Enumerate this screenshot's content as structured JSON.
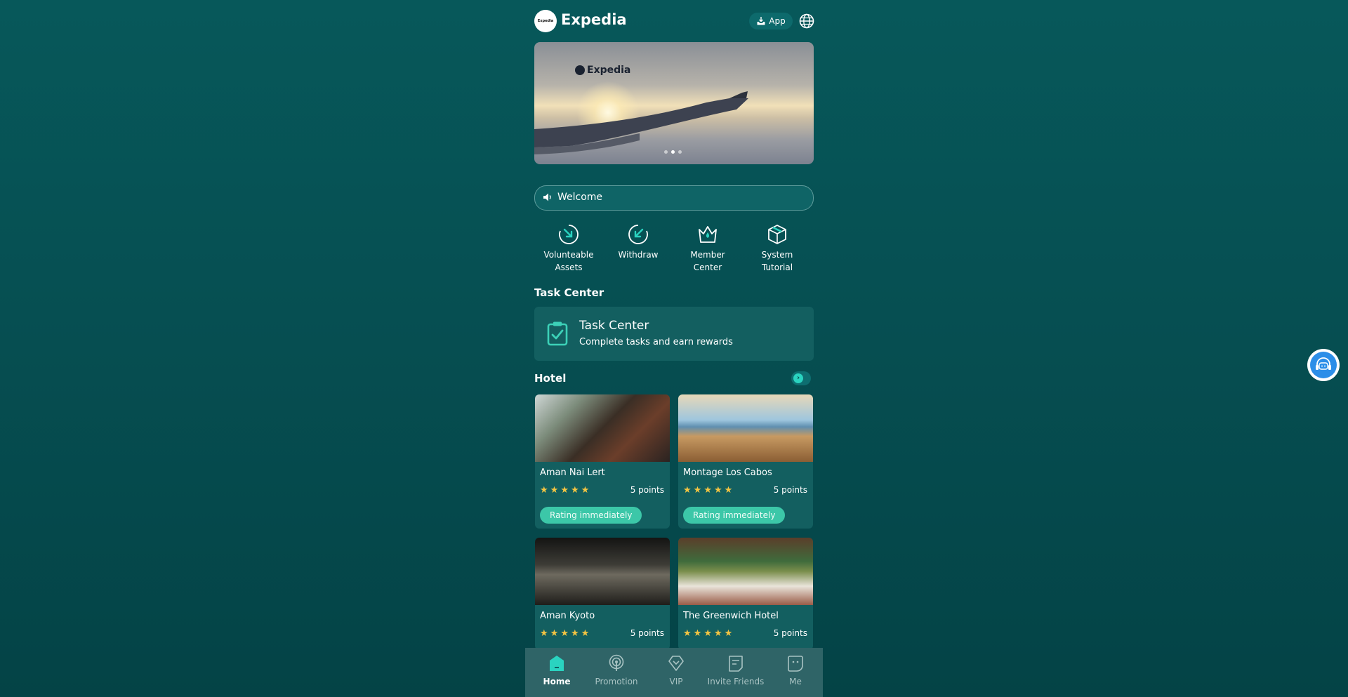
{
  "header": {
    "brand": "Expedia",
    "logo_text": "Expedia",
    "app_label": "App"
  },
  "banner": {
    "logo_text": "Expedia",
    "slide_count": 3,
    "active_slide": 2
  },
  "notice": {
    "text": "Welcome"
  },
  "quick_menu": [
    {
      "label": "Volunteable Assets",
      "icon": "volunteable-assets-icon"
    },
    {
      "label": "Withdraw",
      "icon": "withdraw-icon"
    },
    {
      "label": "Member Center",
      "icon": "member-center-crown-icon"
    },
    {
      "label": "System Tutorial",
      "icon": "system-tutorial-box-icon"
    }
  ],
  "task_section": {
    "title": "Task Center",
    "card_title": "Task Center",
    "card_subtitle": "Complete tasks and earn rewards"
  },
  "hotel_section": {
    "title": "Hotel"
  },
  "hotels": [
    {
      "name": "Aman Nai Lert",
      "stars": 5,
      "points": "5 points",
      "button": "Rating immediately"
    },
    {
      "name": "Montage Los Cabos",
      "stars": 5,
      "points": "5 points",
      "button": "Rating immediately"
    },
    {
      "name": "Aman Kyoto",
      "stars": 5,
      "points": "5 points"
    },
    {
      "name": "The Greenwich Hotel",
      "stars": 5,
      "points": "5 points"
    }
  ],
  "nav": [
    {
      "label": "Home",
      "icon": "home-icon",
      "active": true
    },
    {
      "label": "Promotion",
      "icon": "promotion-icon",
      "active": false
    },
    {
      "label": "VIP",
      "icon": "vip-diamond-icon",
      "active": false
    },
    {
      "label": "Invite Friends",
      "icon": "invite-friends-icon",
      "active": false
    },
    {
      "label": "Me",
      "icon": "me-icon",
      "active": false
    }
  ],
  "colors": {
    "background": "#055255",
    "accent": "#3cc7a8",
    "card": "#135f60",
    "star": "#f5c542",
    "nav": "#2f6467"
  }
}
